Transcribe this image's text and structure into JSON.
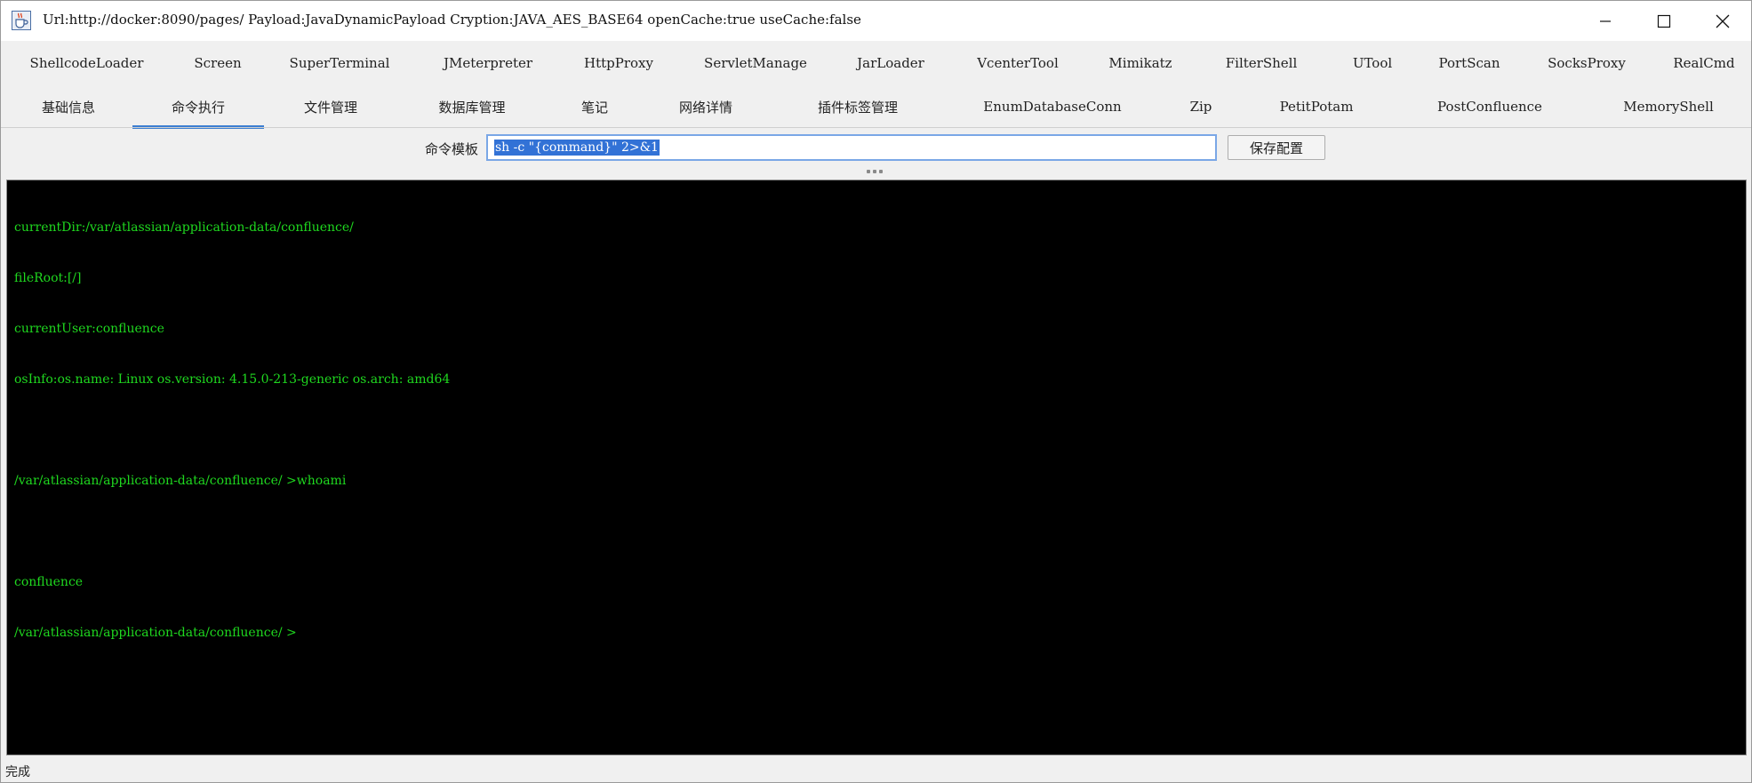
{
  "window": {
    "title": "Url:http://docker:8090/pages/ Payload:JavaDynamicPayload Cryption:JAVA_AES_BASE64 openCache:true useCache:false",
    "app_icon": "java-cup-icon",
    "controls": [
      "minimize-icon",
      "maximize-icon",
      "close-icon"
    ]
  },
  "tabs_row1": [
    {
      "label": "ShellcodeLoader"
    },
    {
      "label": "Screen"
    },
    {
      "label": "SuperTerminal"
    },
    {
      "label": "JMeterpreter"
    },
    {
      "label": "HttpProxy"
    },
    {
      "label": "ServletManage"
    },
    {
      "label": "JarLoader"
    },
    {
      "label": "VcenterTool"
    },
    {
      "label": "Mimikatz"
    },
    {
      "label": "FilterShell"
    },
    {
      "label": "UTool"
    },
    {
      "label": "PortScan"
    },
    {
      "label": "SocksProxy"
    },
    {
      "label": "RealCmd"
    }
  ],
  "tabs_row2": [
    {
      "label": "基础信息"
    },
    {
      "label": "命令执行",
      "active": true
    },
    {
      "label": "文件管理"
    },
    {
      "label": "数据库管理"
    },
    {
      "label": "笔记"
    },
    {
      "label": "网络详情"
    },
    {
      "label": "插件标签管理"
    },
    {
      "label": "EnumDatabaseConn"
    },
    {
      "label": "Zip"
    },
    {
      "label": "PetitPotam"
    },
    {
      "label": "PostConfluence"
    },
    {
      "label": "MemoryShell"
    }
  ],
  "command_template": {
    "label": "命令模板",
    "value": "sh -c \"{command}\" 2>&1",
    "save_label": "保存配置"
  },
  "terminal": {
    "lines": [
      "currentDir:/var/atlassian/application-data/confluence/",
      "fileRoot:[/]",
      "currentUser:confluence",
      "osInfo:os.name: Linux os.version: 4.15.0-213-generic os.arch: amd64",
      "",
      "/var/atlassian/application-data/confluence/ >whoami",
      "",
      "confluence",
      "/var/atlassian/application-data/confluence/ >"
    ],
    "text_color": "#1fd81f",
    "background": "#000000"
  },
  "status": {
    "text": "完成"
  },
  "colors": {
    "accent": "#3d7fd1",
    "selection": "#3272d6"
  }
}
